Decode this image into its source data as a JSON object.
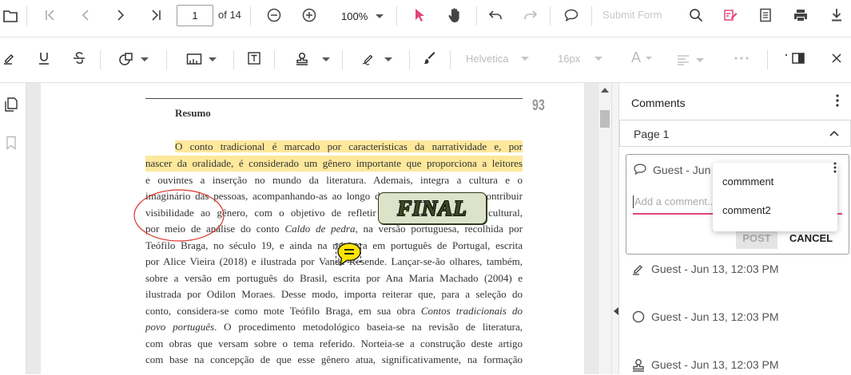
{
  "toolbar": {
    "page_input": "1",
    "page_total": "of 14",
    "zoom": "100%",
    "submit_form": "Submit Form"
  },
  "format_toolbar": {
    "font_family": "Helvetica",
    "font_size": "16px",
    "font_color_glyph": "A"
  },
  "document": {
    "page_number": "93",
    "heading": "Resumo",
    "lines": [
      "O conto tradicional é marcado por características da narratividade e, por",
      "nascer da oralidade, é considerado um gênero importante que proporciona a leitores",
      "e ouvintes a inserção no mundo da literatura. Ademais, integra a cultura e o",
      "imaginário das pessoas, acompanhando-as ao longo do tempo e ajudando a contribuir",
      "visibilidade ao gênero, com o objetivo de refletir acerca do seu caráter cultural,",
      "por meio de análise do conto Caldo de pedra, na versão portuguesa, recolhida por",
      "Teófilo Braga, no século 19, e ainda na releitura em português de Portugal, escrita",
      "por Alice Vieira (2018) e ilustrada por Vanda Resende. Lançar-se-ão olhares, também,",
      "sobre a versão em português do Brasil, escrita por Ana Maria Machado (2004) e",
      "ilustrada por Odilon Moraes. Desse modo, importa reiterar que, para a seleção do",
      "conto, considera-se como mote Teófilo Braga, em sua obra Contos tradicionais do",
      "povo português. O procedimento metodológico baseia-se na revisão de literatura,",
      "com obras que versam sobre o tema referido. Norteia-se a construção deste artigo",
      "com base na concepção de que esse gênero atua, significativamente, na formação"
    ],
    "stamp_text": "FINAL"
  },
  "comments_panel": {
    "title": "Comments",
    "page_group": "Page 1",
    "active_comment_author": "Guest - Jun 1",
    "add_comment_placeholder": "Add a comment...",
    "post_label": "POST",
    "cancel_label": "CANCEL",
    "menu_items": [
      "commment",
      "comment2"
    ],
    "entries": [
      {
        "icon": "pen-icon",
        "text": "Guest - Jun 13, 12:03 PM"
      },
      {
        "icon": "circle-icon",
        "text": "Guest - Jun 13, 12:03 PM"
      },
      {
        "icon": "stamp-icon",
        "text": "Guest - Jun 13, 12:03 PM"
      }
    ]
  },
  "colors": {
    "accent": "#e0457b",
    "highlight": "#fde89c",
    "ink_circle": "#d9342b",
    "stamp_fill": "#dde3c9"
  }
}
